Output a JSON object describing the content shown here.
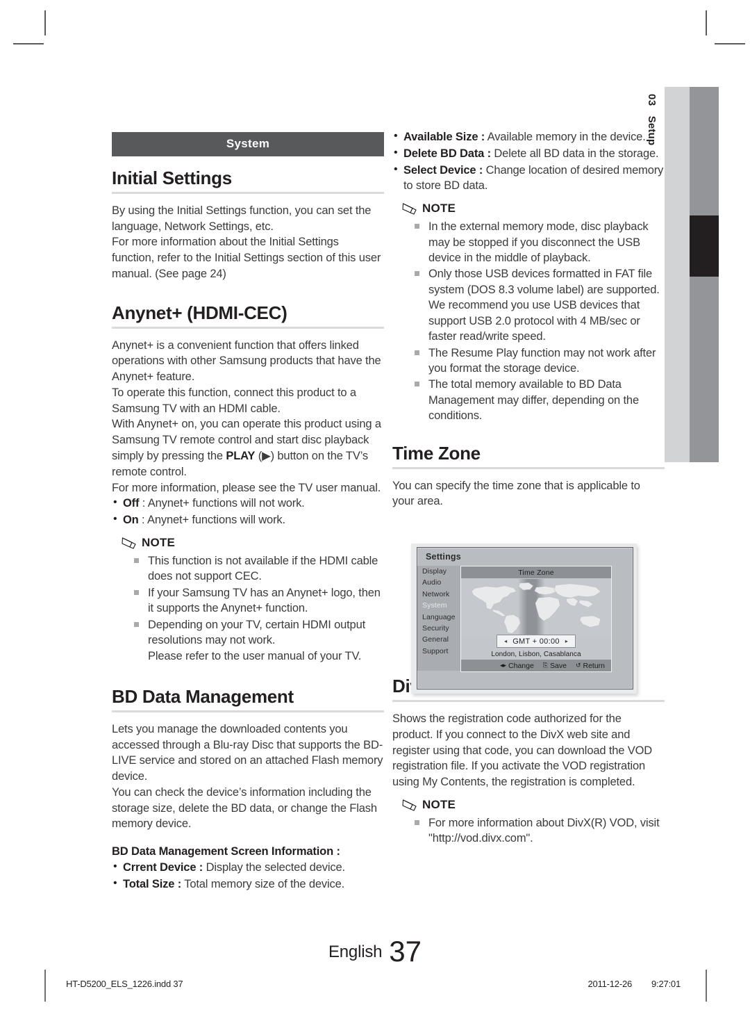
{
  "crop_marks": true,
  "side_tab": {
    "number": "03",
    "label": "Setup"
  },
  "left_column": {
    "section_band": "System",
    "initial_settings": {
      "heading": "Initial Settings",
      "paragraphs": [
        "By using the Initial Settings function, you can set the language, Network Settings, etc.",
        "For more information about the Initial Settings function, refer to the Initial Settings section of this user manual. (See page 24)"
      ]
    },
    "anynet": {
      "heading": "Anynet+ (HDMI-CEC)",
      "paragraphs": [
        "Anynet+ is a convenient function that offers linked operations with other Samsung products that have the Anynet+ feature.",
        "To operate this function, connect this product to a Samsung TV with an HDMI cable.",
        "With Anynet+ on, you can operate this product using a Samsung TV remote control and start disc playback simply by pressing the PLAY (▶) button on the TV’s remote control.",
        "For more information, please see the TV user manual."
      ],
      "play_bold": "PLAY",
      "play_glyph": "▶",
      "bullets": [
        {
          "term": "Off",
          "text": " : Anynet+ functions will not work."
        },
        {
          "term": "On",
          "text": " : Anynet+ functions will work."
        }
      ],
      "note_label": "NOTE",
      "notes": [
        "This function is not available if the HDMI cable does not support CEC.",
        "If your Samsung TV has an Anynet+ logo, then it supports the Anynet+ function.",
        "Depending on your TV, certain HDMI output resolutions may not work.",
        "Please refer to the user manual of your TV."
      ]
    },
    "bd_data": {
      "heading": "BD Data Management",
      "paragraphs": [
        "Lets you manage the downloaded contents you accessed through a Blu-ray Disc that supports the BD-LIVE service and stored on an attached Flash memory device.",
        "You can check the device’s information including the storage size, delete the BD data, or change the Flash memory device."
      ],
      "sub_heading": "BD Data Management Screen Information :",
      "bullets": [
        {
          "term": "Crrent Device :",
          "text": " Display the selected device."
        },
        {
          "term": "Total Size :",
          "text": " Total memory size of the device."
        }
      ]
    }
  },
  "right_column": {
    "bd_data_bullets": [
      {
        "term": "Available Size :",
        "text": " Available memory in the device."
      },
      {
        "term": "Delete BD Data :",
        "text": " Delete all BD data in the storage."
      },
      {
        "term": "Select Device :",
        "text": " Change location of desired memory to store BD data."
      }
    ],
    "note_label": "NOTE",
    "bd_notes": [
      "In the external memory mode, disc playback may be stopped if you disconnect the USB device in the middle of playback.",
      "Only those USB devices formatted in FAT file system (DOS 8.3 volume label) are supported. We recommend you use USB devices that support USB 2.0 protocol with 4 MB/sec or faster read/write speed.",
      "The Resume Play function may not work after you format the storage device.",
      "The total memory available to BD Data Management may differ, depending on the conditions."
    ],
    "time_zone": {
      "heading": "Time Zone",
      "paragraph": "You can specify the time zone that is applicable to your area."
    },
    "divx": {
      "heading": "DivX® Video On Demand",
      "paragraph": "Shows the registration code authorized for the product. If you connect to the DivX web site and register using that code, you can download the VOD registration file. If you activate the VOD registration using My Contents, the registration is completed.",
      "note_label": "NOTE",
      "notes": [
        "For more information about DivX(R) VOD, visit \"http://vod.divx.com\"."
      ]
    }
  },
  "settings_screenshot": {
    "title": "Settings",
    "menu_items": [
      "Display",
      "Audio",
      "Network",
      "System",
      "Language",
      "Security",
      "General",
      "Support"
    ],
    "selected_menu": "System",
    "panel_title": "Time Zone",
    "gmt_value": "GMT + 00:00",
    "left_arrow": "◂",
    "right_arrow": "▸",
    "city_label": "London, Lisbon, Casablanca",
    "footer_actions": [
      {
        "icon": "◂▸",
        "label": "Change"
      },
      {
        "icon": "⎘",
        "label": "Save"
      },
      {
        "icon": "↺",
        "label": "Return"
      }
    ]
  },
  "page_footer": {
    "language": "English",
    "page_number": "37",
    "file_name": "HT-D5200_ELS_1226.indd   37",
    "date": "2011-12-26",
    "time": "9:27:01"
  }
}
